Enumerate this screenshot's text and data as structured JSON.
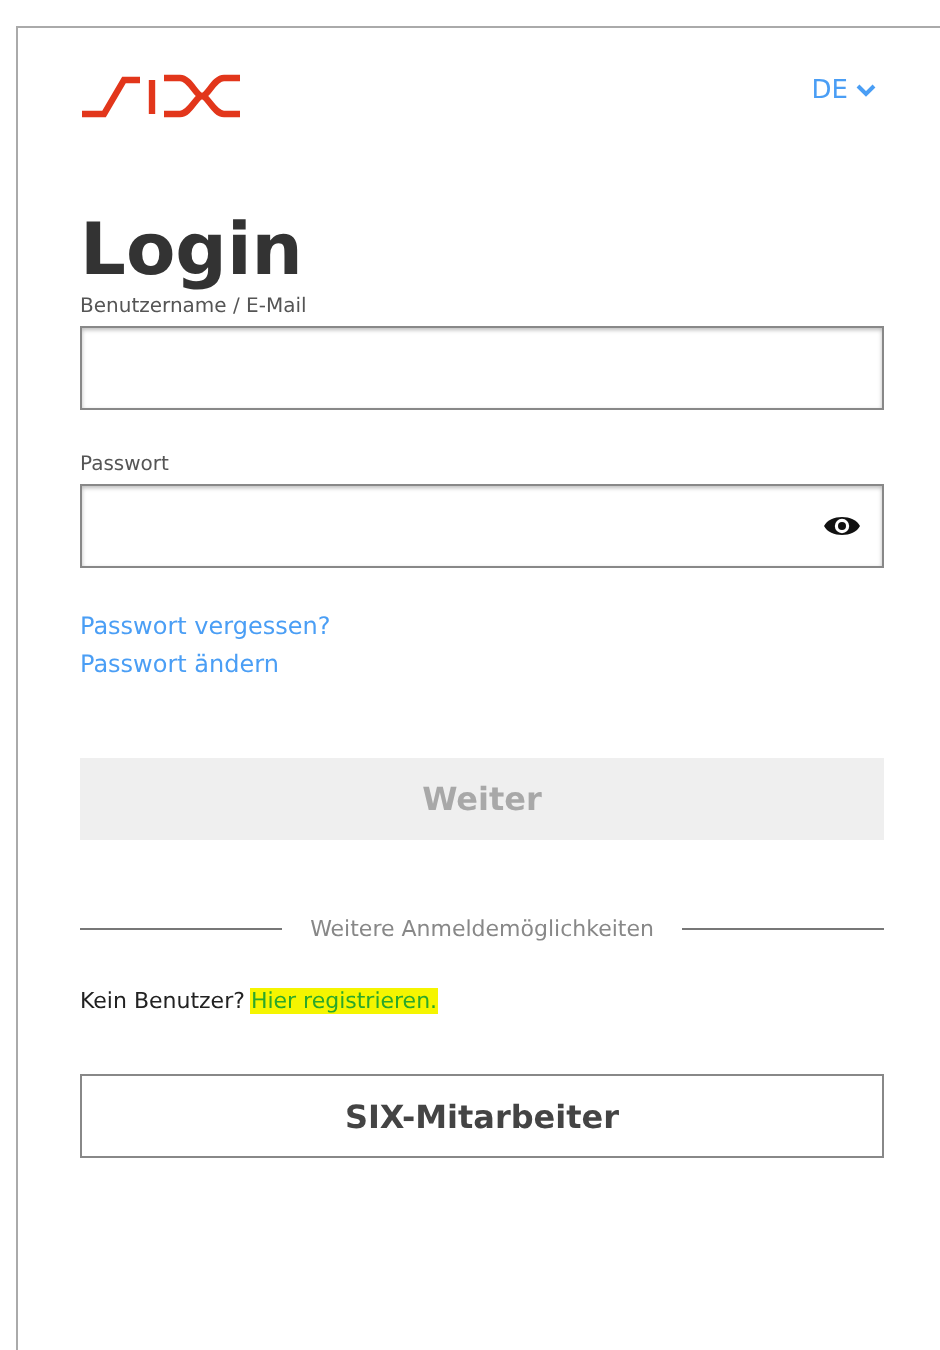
{
  "header": {
    "language": "DE"
  },
  "title": "Login",
  "fields": [
    {
      "label": "Benutzername / E-Mail",
      "kind": "text"
    },
    {
      "label": "Passwort",
      "kind": "password"
    }
  ],
  "links": [
    "Passwort vergessen?",
    "Passwort ändern"
  ],
  "submit": {
    "label": "Weiter",
    "disabled": true
  },
  "divider": "Weitere Anmeldemöglichkeiten",
  "register": {
    "text": "Kein Benutzer?",
    "link": "Hier registrieren.",
    "highlighted": true
  },
  "employee_button": "SIX-Mitarbeiter"
}
